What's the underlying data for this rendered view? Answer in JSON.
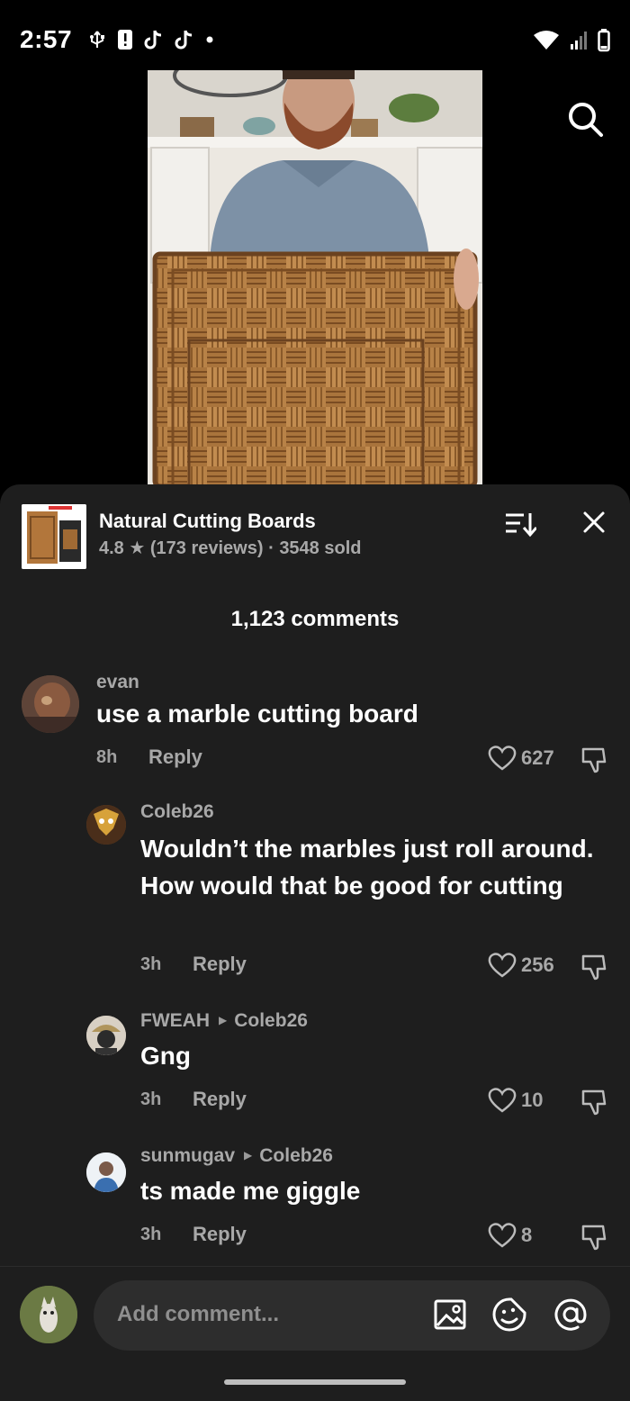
{
  "status_bar": {
    "time": "2:57"
  },
  "product": {
    "name": "Natural Cutting Boards",
    "rating": "4.8",
    "reviews": "(173 reviews)",
    "separator": "·",
    "sold": "3548 sold"
  },
  "comments_header": {
    "count_label": "1,123 comments"
  },
  "comments": [
    {
      "user": "evan",
      "reply_to": "",
      "text": "use a marble cutting board",
      "time": "8h",
      "reply_label": "Reply",
      "likes": "627"
    },
    {
      "user": "Coleb26",
      "reply_to": "",
      "text": "Wouldn’t the marbles just roll around. How would that be good for cutting",
      "time": "3h",
      "reply_label": "Reply",
      "likes": "256"
    },
    {
      "user": "FWEAH",
      "reply_to": "Coleb26",
      "text": "Gng",
      "time": "3h",
      "reply_label": "Reply",
      "likes": "10"
    },
    {
      "user": "sunmugav",
      "reply_to": "Coleb26",
      "text": "ts made me giggle",
      "time": "3h",
      "reply_label": "Reply",
      "likes": "8"
    }
  ],
  "composer": {
    "placeholder": "Add comment..."
  },
  "icons": {
    "search": "search-icon",
    "sort": "sort-icon",
    "close": "close-icon",
    "like": "heart-icon",
    "dislike": "thumbs-down-icon",
    "image": "image-icon",
    "emoji": "emoji-icon",
    "mention": "at-icon"
  },
  "colors": {
    "sheet_bg": "#1e1e1e",
    "input_bg": "#2d2d2d",
    "muted_text": "#a8a8a8"
  }
}
